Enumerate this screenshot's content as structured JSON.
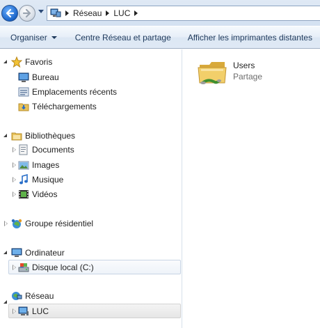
{
  "address": {
    "breadcrumbs": [
      "Réseau",
      "LUC"
    ]
  },
  "toolbar": {
    "organiser_label": "Organiser",
    "centre_label": "Centre Réseau et partage",
    "afficher_label": "Afficher les imprimantes distantes"
  },
  "nav": {
    "favoris": {
      "label": "Favoris",
      "items": [
        "Bureau",
        "Emplacements récents",
        "Téléchargements"
      ]
    },
    "bibliotheques": {
      "label": "Bibliothèques",
      "items": [
        "Documents",
        "Images",
        "Musique",
        "Vidéos"
      ]
    },
    "groupe": {
      "label": "Groupe résidentiel"
    },
    "ordinateur": {
      "label": "Ordinateur",
      "items": [
        "Disque local (C:)"
      ]
    },
    "reseau": {
      "label": "Réseau",
      "items": [
        "LUC"
      ]
    }
  },
  "content": {
    "items": [
      {
        "name": "Users",
        "type": "Partage"
      }
    ]
  },
  "colors": {
    "toolbar_text": "#1e395b",
    "selected_border": "#c7d4e4",
    "folder": "#e8c15a"
  }
}
